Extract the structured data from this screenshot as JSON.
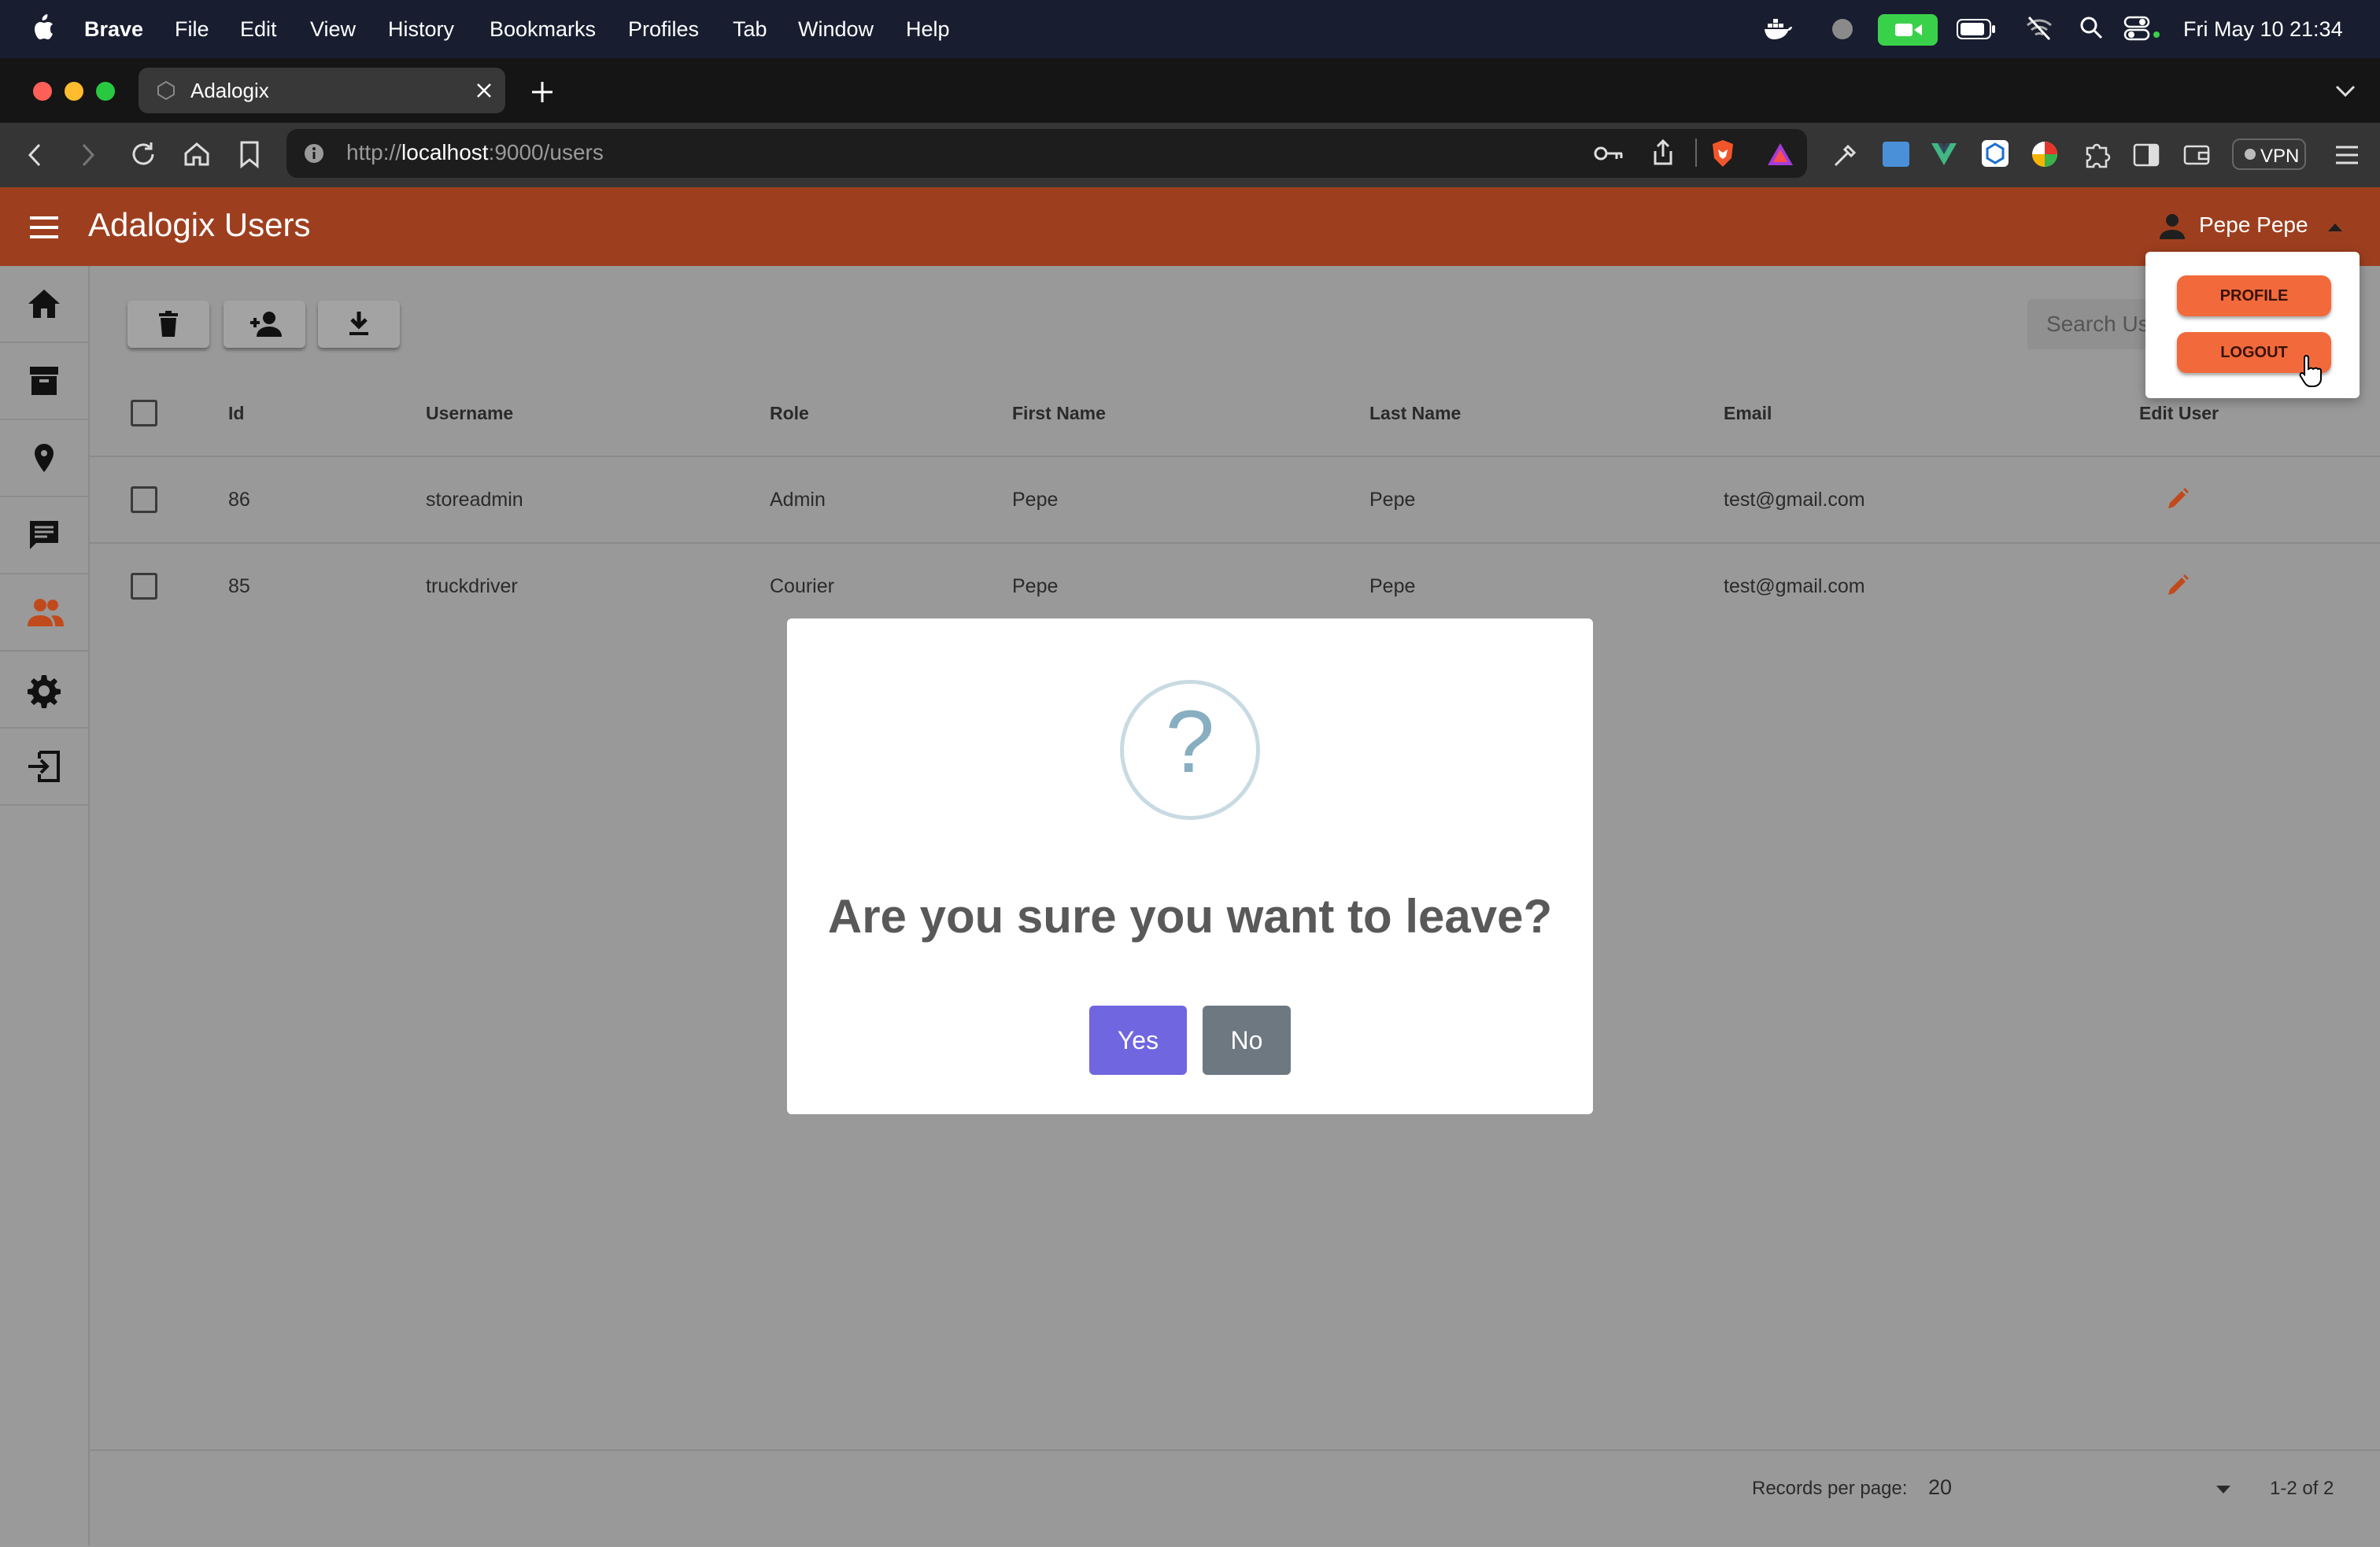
{
  "menubar": {
    "app": "Brave",
    "items": [
      "File",
      "Edit",
      "View",
      "History",
      "Bookmarks",
      "Profiles",
      "Tab",
      "Window",
      "Help"
    ],
    "clock": "Fri May 10  21:34"
  },
  "browser": {
    "tab_title": "Adalogix",
    "url_scheme": "http://",
    "url_host": "localhost",
    "url_rest": ":9000/users",
    "vpn_label": "VPN"
  },
  "app": {
    "title": "Adalogix Users",
    "user_name": "Pepe Pepe",
    "search_placeholder": "Search Users"
  },
  "sidebar": {
    "items": [
      "home-icon",
      "archive-icon",
      "location-pin-icon",
      "chat-icon",
      "users-icon",
      "settings-icon",
      "logout-icon"
    ],
    "active_item": "users-icon"
  },
  "table": {
    "headers": [
      "Id",
      "Username",
      "Role",
      "First Name",
      "Last Name",
      "Email",
      "Edit User"
    ],
    "rows": [
      {
        "id": "86",
        "username": "storeadmin",
        "role": "Admin",
        "first_name": "Pepe",
        "last_name": "Pepe",
        "email": "test@gmail.com"
      },
      {
        "id": "85",
        "username": "truckdriver",
        "role": "Courier",
        "first_name": "Pepe",
        "last_name": "Pepe",
        "email": "test@gmail.com"
      }
    ]
  },
  "footer": {
    "records_label": "Records per page:",
    "records_value": "20",
    "range": "1-2 of 2"
  },
  "user_menu": {
    "profile_label": "PROFILE",
    "logout_label": "LOGOUT"
  },
  "dialog": {
    "icon_glyph": "?",
    "title": "Are you sure you want to leave?",
    "yes_label": "Yes",
    "no_label": "No"
  },
  "colors": {
    "header": "#9d3f1f",
    "accent_orange": "#f26a3b",
    "confirm": "#7066e0",
    "cancel": "#6e7881",
    "edit_icon": "#c14a1c"
  }
}
